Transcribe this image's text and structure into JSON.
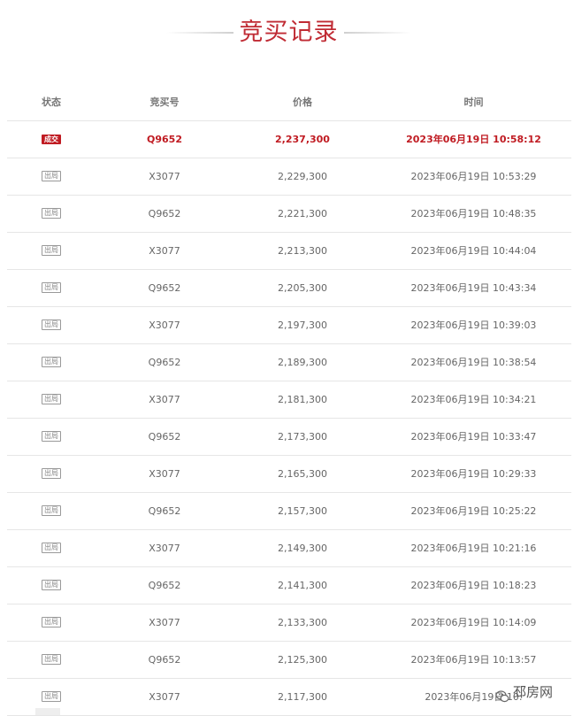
{
  "header": {
    "title": "竞买记录"
  },
  "table": {
    "columns": [
      "状态",
      "竞买号",
      "价格",
      "时间"
    ],
    "rows": [
      {
        "status": "成交",
        "bid_no": "Q9652",
        "price": "2,237,300",
        "time": "2023年06月19日 10:58:12",
        "winner": true
      },
      {
        "status": "出局",
        "bid_no": "X3077",
        "price": "2,229,300",
        "time": "2023年06月19日 10:53:29"
      },
      {
        "status": "出局",
        "bid_no": "Q9652",
        "price": "2,221,300",
        "time": "2023年06月19日 10:48:35"
      },
      {
        "status": "出局",
        "bid_no": "X3077",
        "price": "2,213,300",
        "time": "2023年06月19日 10:44:04"
      },
      {
        "status": "出局",
        "bid_no": "Q9652",
        "price": "2,205,300",
        "time": "2023年06月19日 10:43:34"
      },
      {
        "status": "出局",
        "bid_no": "X3077",
        "price": "2,197,300",
        "time": "2023年06月19日 10:39:03"
      },
      {
        "status": "出局",
        "bid_no": "Q9652",
        "price": "2,189,300",
        "time": "2023年06月19日 10:38:54"
      },
      {
        "status": "出局",
        "bid_no": "X3077",
        "price": "2,181,300",
        "time": "2023年06月19日 10:34:21"
      },
      {
        "status": "出局",
        "bid_no": "Q9652",
        "price": "2,173,300",
        "time": "2023年06月19日 10:33:47"
      },
      {
        "status": "出局",
        "bid_no": "X3077",
        "price": "2,165,300",
        "time": "2023年06月19日 10:29:33"
      },
      {
        "status": "出局",
        "bid_no": "Q9652",
        "price": "2,157,300",
        "time": "2023年06月19日 10:25:22"
      },
      {
        "status": "出局",
        "bid_no": "X3077",
        "price": "2,149,300",
        "time": "2023年06月19日 10:21:16"
      },
      {
        "status": "出局",
        "bid_no": "Q9652",
        "price": "2,141,300",
        "time": "2023年06月19日 10:18:23"
      },
      {
        "status": "出局",
        "bid_no": "X3077",
        "price": "2,133,300",
        "time": "2023年06月19日 10:14:09"
      },
      {
        "status": "出局",
        "bid_no": "Q9652",
        "price": "2,125,300",
        "time": "2023年06月19日 10:13:57"
      },
      {
        "status": "出局",
        "bid_no": "X3077",
        "price": "2,117,300",
        "time": "2023年06月19日 10:"
      }
    ]
  },
  "watermark": {
    "text": "邳房网",
    "icon": "wechat-icon"
  },
  "colors": {
    "accent": "#c02b34",
    "winner": "#c01b22",
    "border": "#e6e6e6"
  }
}
